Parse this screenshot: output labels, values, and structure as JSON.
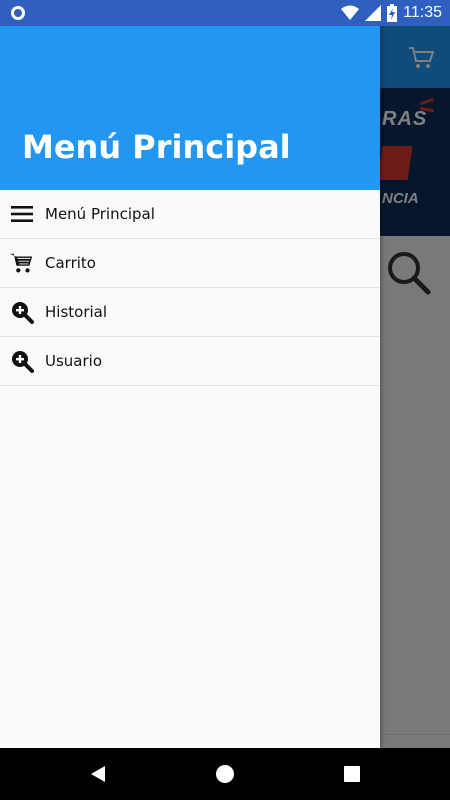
{
  "status_bar": {
    "time": "11:35",
    "icons": [
      "notification-circle-icon",
      "wifi-icon",
      "signal-icon",
      "battery-charging-icon"
    ]
  },
  "drawer": {
    "header_title": "Menú Principal",
    "items": [
      {
        "label": "Menú Principal",
        "icon": "hamburger-menu-icon"
      },
      {
        "label": "Carrito",
        "icon": "shopping-cart-icon"
      },
      {
        "label": "Historial",
        "icon": "zoom-in-icon"
      },
      {
        "label": "Usuario",
        "icon": "zoom-in-icon"
      }
    ]
  },
  "background": {
    "banner_text_top": "RAS",
    "banner_text_bottom": "NCIA",
    "icons": [
      "shopping-cart-icon",
      "search-icon"
    ]
  },
  "colors": {
    "primary": "#2196F3",
    "status_bar": "#2f60c0",
    "banner": "#0c2c58",
    "accent_red": "#d8382e"
  },
  "nav_bar": {
    "buttons": [
      "back-icon",
      "home-icon",
      "recents-icon"
    ]
  }
}
